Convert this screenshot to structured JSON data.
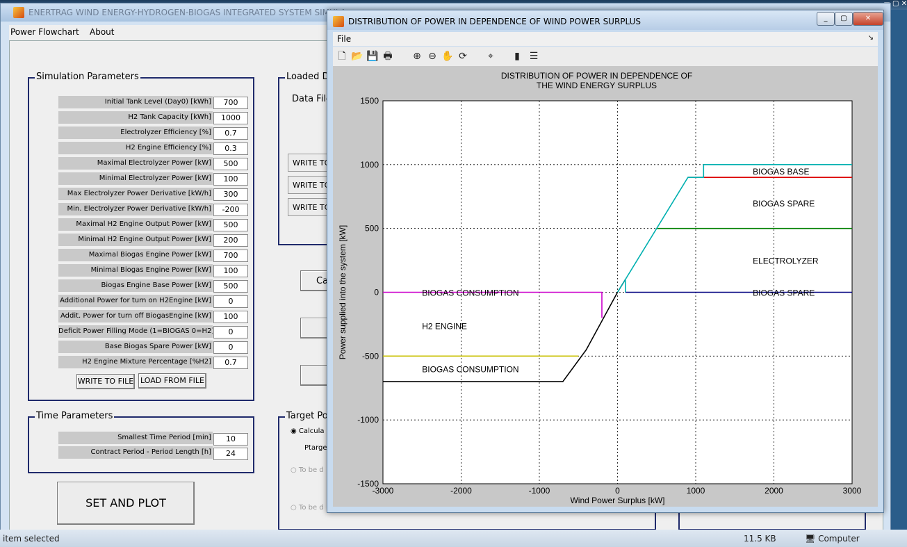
{
  "main_window": {
    "title": "ENERTRAG WIND ENERGY-HYDROGEN-BIOGAS INTEGRATED SYSTEM SIMULA",
    "menu": [
      "Power Flowchart",
      "About"
    ]
  },
  "sim_params": {
    "title": "Simulation Parameters",
    "rows": [
      {
        "label": "Initial Tank Level (Day0) [kWh]",
        "value": "700"
      },
      {
        "label": "H2 Tank Capacity [kWh]",
        "value": "1000"
      },
      {
        "label": "Electrolyzer Efficiency [%]",
        "value": "0.7"
      },
      {
        "label": "H2 Engine Efficiency [%]",
        "value": "0.3"
      },
      {
        "label": "Maximal Electrolyzer Power [kW]",
        "value": "500"
      },
      {
        "label": "Minimal Electrolyzer Power [kW]",
        "value": "100"
      },
      {
        "label": "Max Electrolyzer Power Derivative [kW/h]",
        "value": "300"
      },
      {
        "label": "Min. Electrolyzer Power Derivative [kW/h]",
        "value": "-200"
      },
      {
        "label": "Maximal H2 Engine Output Power [kW]",
        "value": "500"
      },
      {
        "label": "Minimal H2 Engine Output Power [kW]",
        "value": "200"
      },
      {
        "label": "Maximal Biogas Engine Power [kW]",
        "value": "700"
      },
      {
        "label": "Minimal Biogas Engine Power [kW]",
        "value": "100"
      },
      {
        "label": "Biogas Engine Base Power [kW]",
        "value": "500"
      },
      {
        "label": "Additional Power for turn on H2Engine [kW]",
        "value": "0"
      },
      {
        "label": "Addit. Power for turn off BiogasEngine [kW]",
        "value": "100"
      },
      {
        "label": "Deficit Power Filling Mode (1=BIOGAS 0=H2)",
        "value": "0"
      },
      {
        "label": "Base Biogas Spare Power [kW]",
        "value": "0"
      },
      {
        "label": "H2 Engine Mixture Percentage [%H2]",
        "value": "0.7"
      }
    ],
    "write_btn": "WRITE TO FILE",
    "load_btn": "LOAD FROM FILE"
  },
  "time_params": {
    "title": "Time Parameters",
    "rows": [
      {
        "label": "Smallest Time Period [min]",
        "value": "10"
      },
      {
        "label": "Contract Period - Period Length [h]",
        "value": "24"
      }
    ]
  },
  "set_plot_btn": "SET AND PLOT",
  "loaded_group": {
    "title": "Loaded D",
    "data_file_label": "Data File",
    "write_buttons": [
      "WRITE TO",
      "WRITE TO",
      "WRITE TO"
    ],
    "calc_btn": "Ca"
  },
  "target_group": {
    "title": "Target Po",
    "opt1": "Calcula",
    "ptarget_label": "Ptarge",
    "opt2": "To be d",
    "opt3": "To be d"
  },
  "taskbar": {
    "status": "item selected",
    "size": "11.5 KB",
    "computer": "Computer"
  },
  "figure_window": {
    "title": "DISTRIBUTION OF POWER IN DEPENDENCE OF WIND POWER SURPLUS",
    "menu_file": "File",
    "tool_icons": [
      "new-icon",
      "open-icon",
      "save-icon",
      "print-icon",
      "zoom-in-icon",
      "zoom-out-icon",
      "pan-icon",
      "rotate-icon",
      "data-cursor-icon",
      "colorbar-icon",
      "legend-icon"
    ]
  },
  "chart_data": {
    "type": "line",
    "title": "DISTRIBUTION OF POWER IN DEPENDENCE OF\nTHE WIND ENERGY SURPLUS",
    "xlabel": "Wind Power Surplus [kW]",
    "ylabel": "Power supplied into the system [kW]",
    "xlim": [
      -3000,
      3000
    ],
    "ylim": [
      -1500,
      1500
    ],
    "xticks": [
      -3000,
      -2000,
      -1000,
      0,
      1000,
      2000,
      3000
    ],
    "yticks": [
      -1500,
      -1000,
      -500,
      0,
      500,
      1000,
      1500
    ],
    "grid": true,
    "series": [
      {
        "color": "#000000",
        "points": [
          [
            -3000,
            -700
          ],
          [
            -700,
            -700
          ],
          [
            -400,
            -450
          ],
          [
            0,
            0
          ],
          [
            100,
            100
          ]
        ]
      },
      {
        "color": "#cc00cc",
        "points": [
          [
            -3000,
            0
          ],
          [
            -200,
            0
          ],
          [
            -200,
            -200
          ]
        ]
      },
      {
        "color": "#c8c000",
        "points": [
          [
            -3000,
            -500
          ],
          [
            -500,
            -500
          ]
        ]
      },
      {
        "color": "#000080",
        "points": [
          [
            100,
            0
          ],
          [
            3000,
            0
          ]
        ]
      },
      {
        "color": "#008000",
        "points": [
          [
            500,
            500
          ],
          [
            3000,
            500
          ]
        ]
      },
      {
        "color": "#dd0000",
        "points": [
          [
            900,
            900
          ],
          [
            3000,
            900
          ]
        ]
      },
      {
        "color": "#00b0b0",
        "points": [
          [
            0,
            0
          ],
          [
            100,
            100
          ],
          [
            100,
            0
          ],
          [
            100,
            100
          ],
          [
            500,
            500
          ],
          [
            900,
            900
          ],
          [
            1100,
            900
          ],
          [
            1100,
            1000
          ],
          [
            3000,
            1000
          ]
        ]
      }
    ],
    "annotations": [
      {
        "text": "BIOGAS BASE",
        "x": 1730,
        "y": 950
      },
      {
        "text": "BIOGAS SPARE",
        "x": 1730,
        "y": 700
      },
      {
        "text": "ELECTROLYZER",
        "x": 1730,
        "y": 250
      },
      {
        "text": "BIOGAS SPARE",
        "x": 1730,
        "y": 0
      },
      {
        "text": "BIOGAS CONSUMPTION",
        "x": -2500,
        "y": 0
      },
      {
        "text": "H2 ENGINE",
        "x": -2500,
        "y": -260
      },
      {
        "text": "BIOGAS CONSUMPTION",
        "x": -2500,
        "y": -600
      }
    ]
  }
}
